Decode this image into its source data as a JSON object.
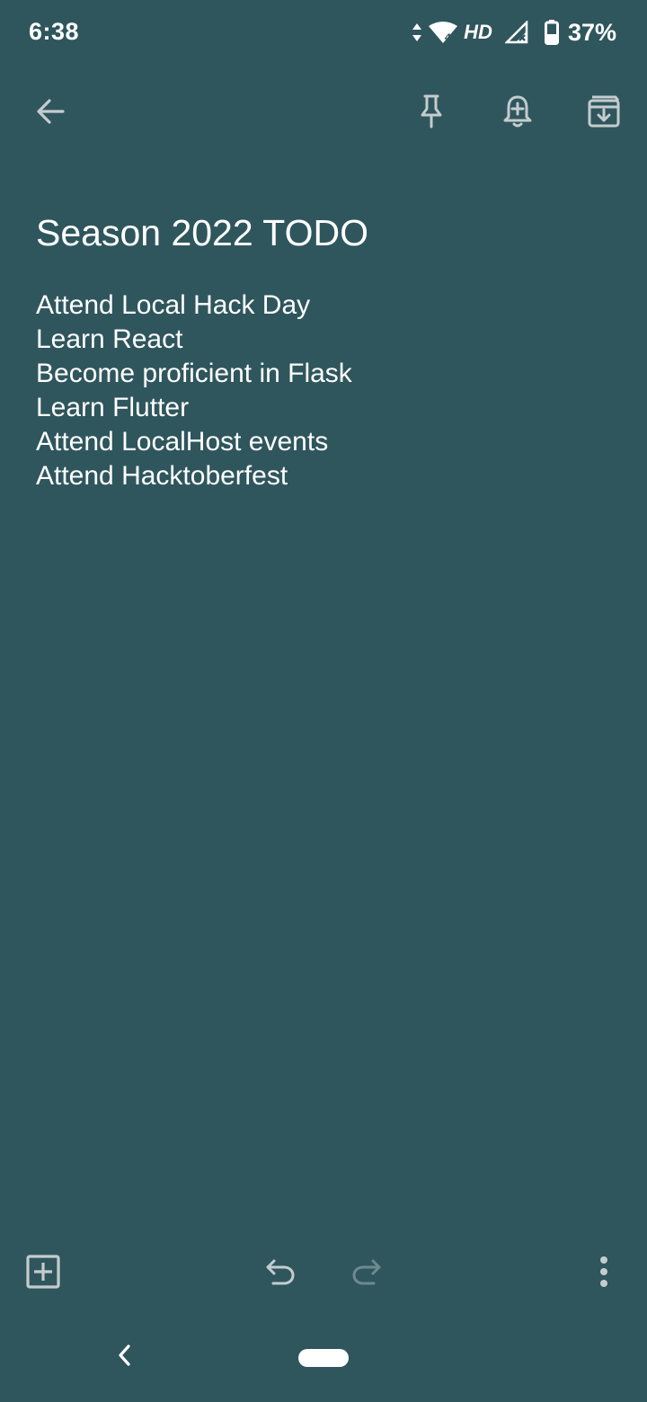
{
  "status_bar": {
    "time": "6:38",
    "network_label": "HD",
    "battery_percent": "37%",
    "icons": [
      "data-arrows-icon",
      "wifi-icon",
      "signal-icon",
      "battery-icon"
    ]
  },
  "toolbar": {
    "icons": [
      "back-arrow-icon",
      "pin-icon",
      "reminder-bell-icon",
      "archive-icon"
    ]
  },
  "note": {
    "title": "Season 2022 TODO",
    "lines": [
      "Attend Local Hack Day",
      "Learn React",
      "Become proficient in Flask",
      "Learn Flutter",
      "Attend LocalHost events",
      "Attend Hacktoberfest"
    ]
  },
  "bottom_bar": {
    "icons": [
      "add-box-icon",
      "undo-icon",
      "redo-icon",
      "more-vert-icon"
    ],
    "redo_enabled": false
  },
  "colors": {
    "background": "#2f565d",
    "icon": "#c4ccce",
    "icon_disabled": "#6e8a8f",
    "text": "#ffffff"
  }
}
